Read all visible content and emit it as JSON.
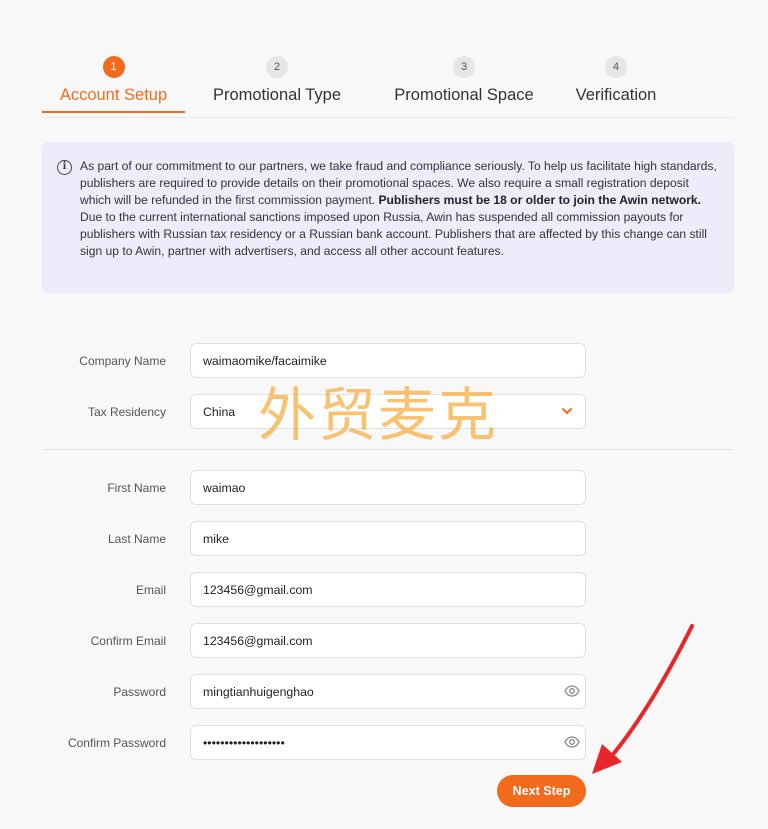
{
  "stepper": {
    "steps": [
      {
        "number": "1",
        "label": "Account Setup"
      },
      {
        "number": "2",
        "label": "Promotional Type"
      },
      {
        "number": "3",
        "label": "Promotional Space"
      },
      {
        "number": "4",
        "label": "Verification"
      }
    ],
    "active_step": 1
  },
  "notice": {
    "icon": "info-icon",
    "p1_text": "As part of our commitment to our partners, we take fraud and compliance seriously. To help us facilitate high standards, publishers are required to provide details on their promotional spaces. We also require a small registration deposit which will be refunded in the first commission payment. ",
    "p1_bold": "Publishers must be 18 or older to join the Awin network.",
    "p2_text": "Due to the current international sanctions imposed upon Russia, Awin has suspended all commission payouts for publishers with Russian tax residency or a Russian bank account. Publishers that are affected by this change can still sign up to Awin, partner with advertisers, and access all other account features."
  },
  "form": {
    "company_name": {
      "label": "Company Name",
      "value": "waimaomike/facaimike"
    },
    "tax_residency": {
      "label": "Tax Residency",
      "value": "China"
    },
    "first_name": {
      "label": "First Name",
      "value": "waimao"
    },
    "last_name": {
      "label": "Last Name",
      "value": "mike"
    },
    "email": {
      "label": "Email",
      "value": "123456@gmail.com"
    },
    "confirm_email": {
      "label": "Confirm Email",
      "value": "123456@gmail.com"
    },
    "password": {
      "label": "Password",
      "value": "mingtianhuigenghao"
    },
    "confirm_password": {
      "label": "Confirm Password",
      "value": "•••••••••••••••••••"
    },
    "next_label": "Next Step"
  },
  "watermark": "外贸麦克",
  "colors": {
    "accent": "#f26b1d",
    "notice_bg": "#ececfa",
    "arrow": "#e8262a",
    "watermark": "#f7b24a"
  }
}
